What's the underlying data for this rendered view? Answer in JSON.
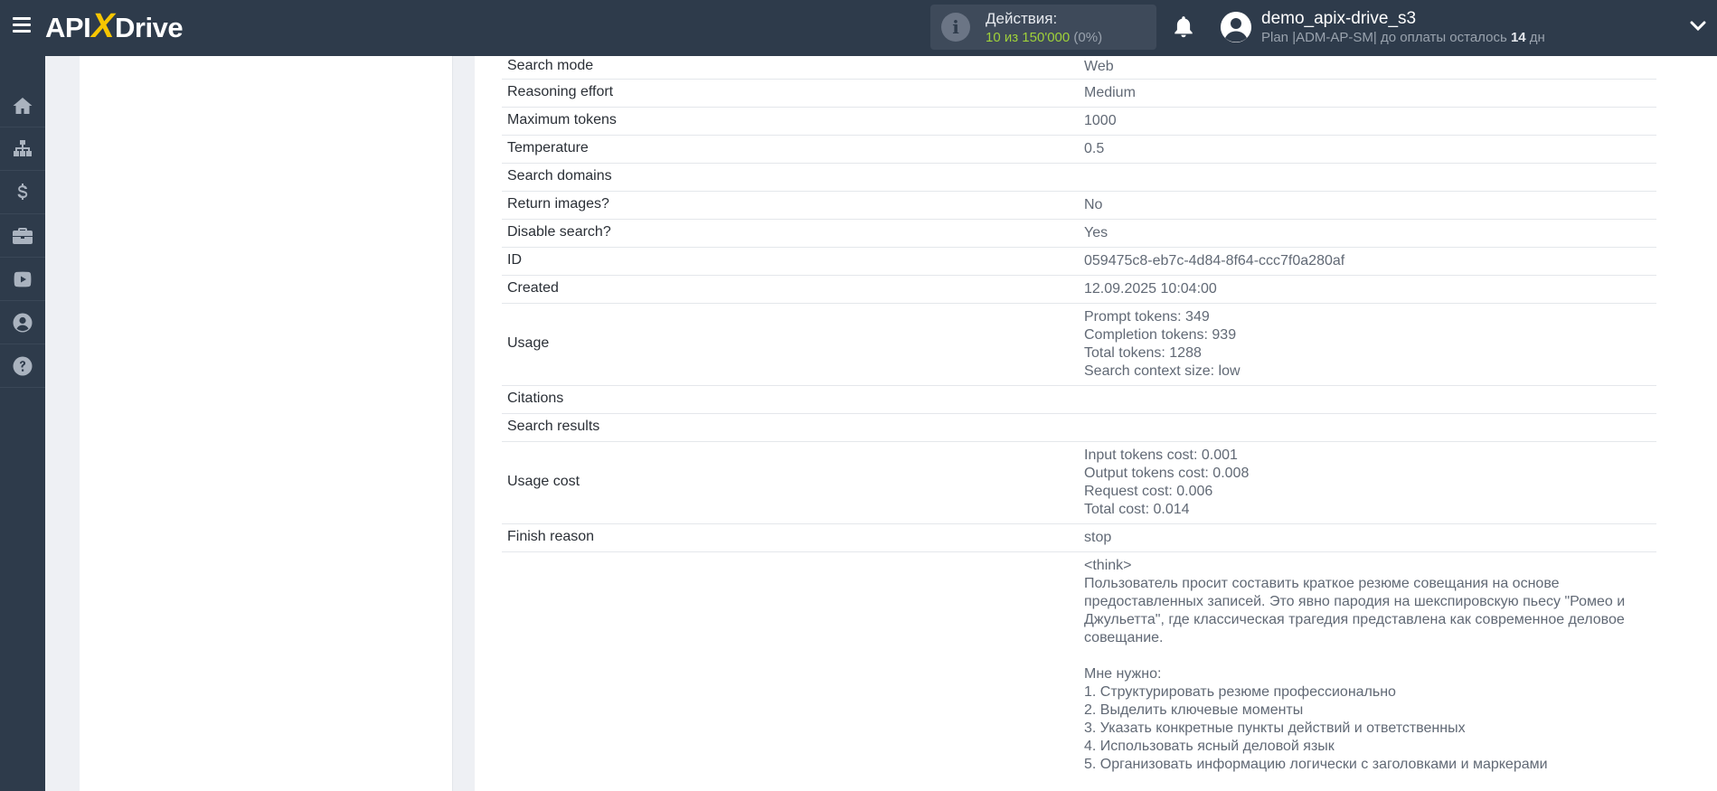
{
  "header": {
    "logo": {
      "part1": "API",
      "x": "X",
      "part2": "Drive"
    },
    "actions": {
      "title": "Действия:",
      "used": "10",
      "of": "из",
      "limit": "150'000",
      "percent": "(0%)"
    },
    "user": {
      "name": "demo_apix-drive_s3",
      "plan_text": "Plan |ADM-AP-SM| до оплаты осталось",
      "days": "14",
      "days_unit": "дн"
    }
  },
  "sidebar": {
    "items": [
      {
        "name": "home-icon"
      },
      {
        "name": "sitemap-icon"
      },
      {
        "name": "dollar-icon"
      },
      {
        "name": "briefcase-icon"
      },
      {
        "name": "youtube-icon"
      },
      {
        "name": "user-circle-icon"
      },
      {
        "name": "question-icon"
      }
    ]
  },
  "table": {
    "rows": [
      {
        "label": "Search mode",
        "values": [
          "Web"
        ]
      },
      {
        "label": "Reasoning effort",
        "values": [
          "Medium"
        ]
      },
      {
        "label": "Maximum tokens",
        "values": [
          "1000"
        ]
      },
      {
        "label": "Temperature",
        "values": [
          "0.5"
        ]
      },
      {
        "label": "Search domains",
        "values": []
      },
      {
        "label": "Return images?",
        "values": [
          "No"
        ]
      },
      {
        "label": "Disable search?",
        "values": [
          "Yes"
        ]
      },
      {
        "label": "ID",
        "values": [
          "059475c8-eb7c-4d84-8f64-ccc7f0a280af"
        ]
      },
      {
        "label": "Created",
        "values": [
          "12.09.2025 10:04:00"
        ]
      },
      {
        "label": "Usage",
        "values": [
          "Prompt tokens: 349",
          "Completion tokens: 939",
          "Total tokens: 1288",
          "Search context size: low"
        ]
      },
      {
        "label": "Citations",
        "values": []
      },
      {
        "label": "Search results",
        "values": []
      },
      {
        "label": "Usage cost",
        "values": [
          "Input tokens cost: 0.001",
          "Output tokens cost: 0.008",
          "Request cost: 0.006",
          "Total cost: 0.014"
        ]
      },
      {
        "label": "Finish reason",
        "values": [
          "stop"
        ]
      },
      {
        "label": "",
        "values": [
          "<think>",
          "Пользователь просит составить краткое резюме совещания на основе",
          "предоставленных записей. Это явно пародия на шекспировскую пьесу \"Ромео и",
          "Джульетта\", где классическая трагедия представлена как современное деловое",
          "совещание.",
          "",
          "Мне нужно:",
          "1. Структурировать резюме профессионально",
          "2. Выделить ключевые моменты",
          "3. Указать конкретные пункты действий и ответственных",
          "4. Использовать ясный деловой язык",
          "5. Организовать информацию логически с заголовками и маркерами"
        ]
      }
    ]
  },
  "colors": {
    "header_bg": "#2e3b4b",
    "accent_yellow": "#f7c600",
    "accent_green": "#9fd13a",
    "page_bg": "#eef0f4"
  }
}
